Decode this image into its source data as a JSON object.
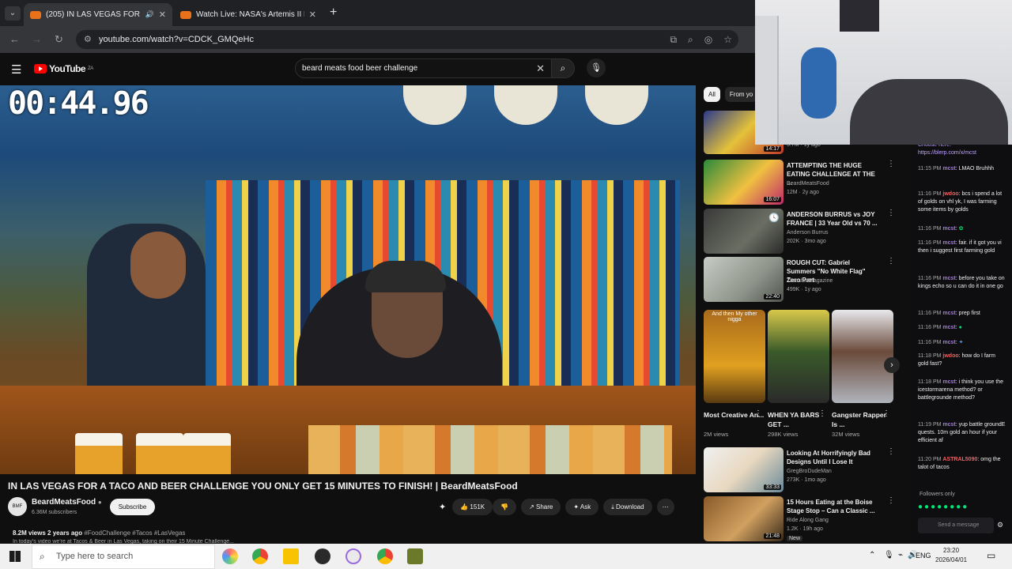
{
  "browser": {
    "tabs": [
      {
        "label": "(205) IN LAS VEGAS FOR A",
        "active": true
      },
      {
        "label": "Watch Live: NASA's Artemis II L",
        "active": false
      }
    ],
    "url": "youtube.com/watch?v=CDCK_GMQeHc"
  },
  "youtube": {
    "logo_text": "YouTube",
    "logo_region": "ZA",
    "search_query": "beard meats food beer challenge"
  },
  "video": {
    "timer_overlay": "00:44.96",
    "title": "IN LAS VEGAS FOR A TACO AND BEER CHALLENGE YOU ONLY GET 15 MINUTES TO FINISH! | BeardMeatsFood",
    "channel": "BeardMeatsFood",
    "subscribers": "6.36M subscribers",
    "subscribe_label": "Subscribe",
    "likes": "151K",
    "share_label": "Share",
    "ask_label": "Ask",
    "download_label": "Download",
    "views": "8.2M views",
    "age": "2 years ago",
    "tags": "#FoodChallenge #Tacos #LasVegas",
    "description": "In today's video we're at Tacos & Beer in Las Vegas, taking on their 15 Minute Challenge..."
  },
  "filters": {
    "all": "All",
    "from": "From yo"
  },
  "recommendations": [
    {
      "title": "",
      "channel": "",
      "meta": "3.7M · 1y ago",
      "duration": "14:17"
    },
    {
      "title": "ATTEMPTING THE HUGE EATING CHALLENGE AT THE ...",
      "channel": "BeardMeatsFood",
      "meta": "12M · 2y ago",
      "duration": "16:07"
    },
    {
      "title": "ANDERSON BURRUS vs JOY FRANCE | 33 Year Old vs 70 ...",
      "channel": "Anderson Burrus",
      "meta": "202K · 3mo ago",
      "duration": ""
    },
    {
      "title": "ROUGH CUT: Gabriel Summers \"No White Flag\" Zero Part",
      "channel": "ThrasherMagazine",
      "meta": "499K · 1y ago",
      "duration": "22:40"
    },
    {
      "title": "Looking At Horrifyingly Bad Designs Until I Lose It",
      "channel": "GregBroDudeMan",
      "meta": "273K · 1mo ago",
      "duration": "33:33"
    },
    {
      "title": "15 Hours Eating at the Boise Stage Stop – Can a Classic ...",
      "channel": "Ride Along Gang",
      "meta": "1.2K · 19h ago",
      "duration": "21:48",
      "badge": "New"
    }
  ],
  "shorts": [
    {
      "title": "Most Creative An...",
      "views": "2M views",
      "caption": "And then My other nigga"
    },
    {
      "title": "WHEN YA BARS GET ...",
      "views": "298K views"
    },
    {
      "title": "Gangster Rapper Is ...",
      "views": "32M views"
    }
  ],
  "chat": {
    "link": "Choose here: https://blerp.com/x/mcst",
    "messages": [
      {
        "time": "11:15 PM",
        "user": "mcst",
        "text": "LMAO Bruhhh"
      },
      {
        "time": "11:16 PM",
        "user": "jwdoo",
        "text": "bcs i spend a lot of golds on vhl yk, I was farming some items by golds"
      },
      {
        "time": "11:16 PM",
        "user": "mcst",
        "text": ""
      },
      {
        "time": "11:16 PM",
        "user": "mcst",
        "text": "fair. if it got you vi then i suggest first farming gold"
      },
      {
        "time": "11:16 PM",
        "user": "mcst",
        "text": "before you take on kings echo so u can do it in one go"
      },
      {
        "time": "11:16 PM",
        "user": "mcst",
        "text": "prep first"
      },
      {
        "time": "11:16 PM",
        "user": "mcst",
        "text": ""
      },
      {
        "time": "11:16 PM",
        "user": "mcst",
        "text": ""
      },
      {
        "time": "11:18 PM",
        "user": "jwdoo",
        "text": "how do I farm gold fast?"
      },
      {
        "time": "11:18 PM",
        "user": "mcst",
        "text": "i think you use the icestormarena method? or battlegrounde method?"
      },
      {
        "time": "11:19 PM",
        "user": "mcst",
        "text": "yup battle groundE quests. 10m gold an hour if your efficient af"
      },
      {
        "time": "11:20 PM",
        "user": "ASTRAL5090",
        "text": "omg the talot of tacos"
      }
    ],
    "followers_only": "Followers only",
    "send_placeholder": "Send a message"
  },
  "taskbar": {
    "search_placeholder": "Type here to search",
    "language": "ENG",
    "time": "23:20",
    "date": "2026/04/01"
  }
}
